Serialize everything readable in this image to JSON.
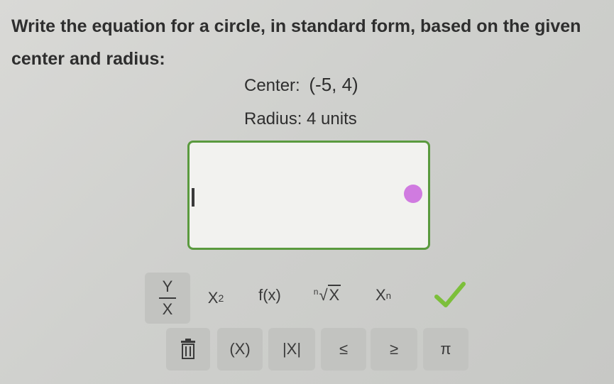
{
  "question": {
    "prompt": "Write the equation for a circle, in standard form, based on the given center and radius:",
    "center_label": "Center:",
    "center_value": "(-5, 4)",
    "radius_text": "Radius: 4 units"
  },
  "answer": {
    "value": ""
  },
  "keypad": {
    "fraction_top": "Y",
    "fraction_bottom": "X",
    "power_base": "X",
    "power_exp": "2",
    "function": "f(x)",
    "root_index": "n",
    "root_radicand": "X",
    "subscript_base": "X",
    "subscript_idx": "n",
    "paren": "(X)",
    "abs": "|X|",
    "leq": "≤",
    "geq": "≥",
    "pi": "π"
  },
  "colors": {
    "box_border": "#5a9a3e",
    "check": "#7cbf3a",
    "toggle": "#d07be0"
  },
  "icons": [
    "check-icon",
    "trash-icon"
  ]
}
